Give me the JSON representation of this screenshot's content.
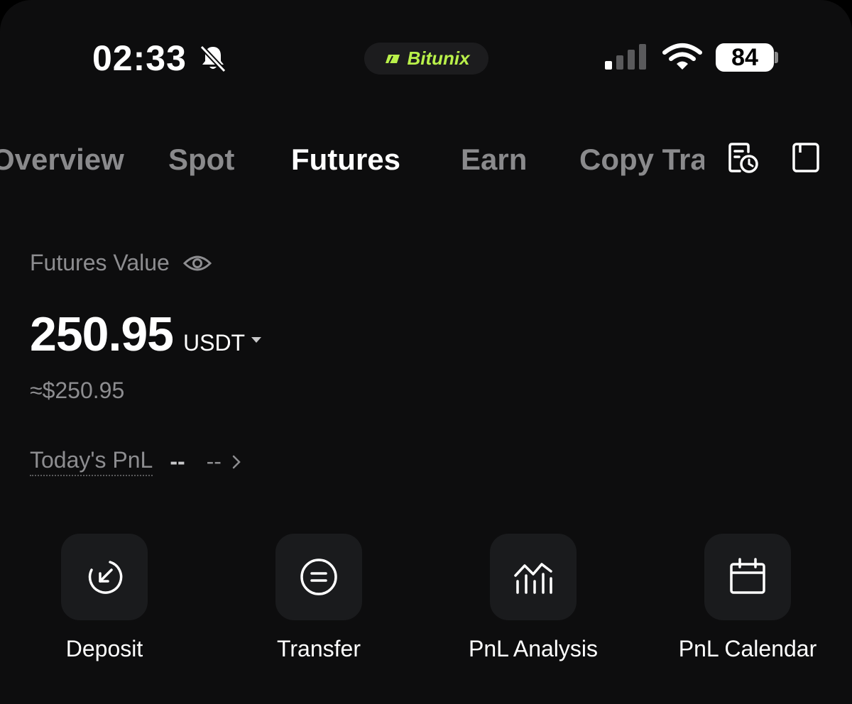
{
  "status_bar": {
    "time": "02:33",
    "carrier_app": "Bitunix",
    "battery": "84",
    "icons": [
      "bell-slash-icon",
      "cellular-signal-icon",
      "wifi-icon",
      "battery-icon"
    ]
  },
  "colors": {
    "background": "#0d0d0e",
    "brand_accent": "#b9f04a",
    "muted_text": "#8d8d90",
    "tile_background": "#1a1b1d"
  },
  "tabs": [
    {
      "label": "Overview",
      "active": false
    },
    {
      "label": "Spot",
      "active": false
    },
    {
      "label": "Futures",
      "active": true
    },
    {
      "label": "Earn",
      "active": false
    },
    {
      "label": "Copy Trading",
      "active": false
    }
  ],
  "header_icons": [
    "order-history-icon",
    "notebook-icon"
  ],
  "balance": {
    "label": "Futures Value",
    "amount": "250.95",
    "currency": "USDT",
    "approx": "≈$250.95"
  },
  "pnl": {
    "label": "Today's PnL",
    "value": "--",
    "percent": "--"
  },
  "actions": [
    {
      "label": "Deposit",
      "icon": "deposit-icon"
    },
    {
      "label": "Transfer",
      "icon": "transfer-icon"
    },
    {
      "label": "PnL Analysis",
      "icon": "analysis-chart-icon"
    },
    {
      "label": "PnL Calendar",
      "icon": "calendar-icon"
    }
  ]
}
